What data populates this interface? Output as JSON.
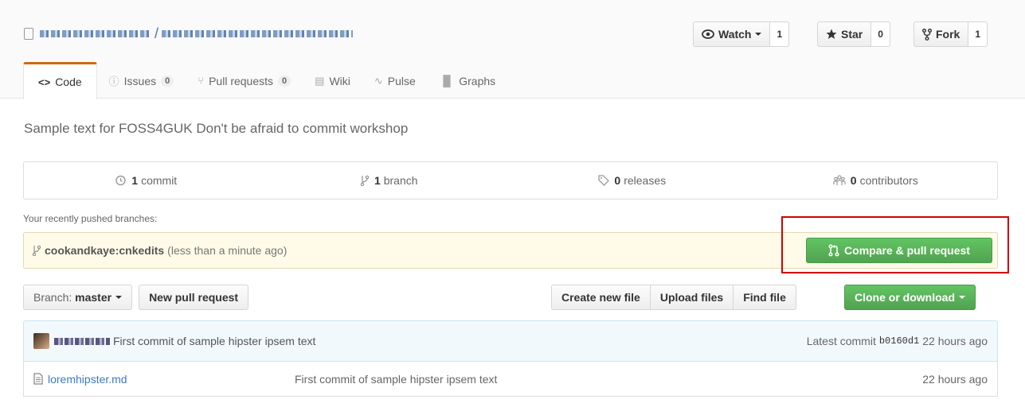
{
  "repo": {
    "owner_blurred": "",
    "name_blurred": "",
    "separator": "/"
  },
  "social": {
    "watch_label": "Watch",
    "watch_count": "1",
    "star_label": "Star",
    "star_count": "0",
    "fork_label": "Fork",
    "fork_count": "1"
  },
  "tabs": [
    {
      "label": "Code",
      "icon": "code-icon"
    },
    {
      "label": "Issues",
      "counter": "0",
      "icon": "issue-icon"
    },
    {
      "label": "Pull requests",
      "counter": "0",
      "icon": "pull-request-icon"
    },
    {
      "label": "Wiki",
      "icon": "book-icon"
    },
    {
      "label": "Pulse",
      "icon": "pulse-icon"
    },
    {
      "label": "Graphs",
      "icon": "graph-icon"
    }
  ],
  "description": "Sample text for FOSS4GUK Don't be afraid to commit workshop",
  "summary": {
    "commits_count": "1",
    "commits_label": "commit",
    "branches_count": "1",
    "branches_label": "branch",
    "releases_count": "0",
    "releases_label": "releases",
    "contributors_count": "0",
    "contributors_label": "contributors"
  },
  "recent": {
    "label": "Your recently pushed branches:",
    "branch": "cookandkaye:cnkedits",
    "ago": "(less than a minute ago)",
    "compare_button": "Compare & pull request"
  },
  "filebar": {
    "branch_prefix": "Branch:",
    "branch_name": "master",
    "new_pr": "New pull request",
    "create_file": "Create new file",
    "upload_files": "Upload files",
    "find_file": "Find file",
    "clone": "Clone or download"
  },
  "latest_commit": {
    "message": "First commit of sample hipster ipsem text",
    "prefix": "Latest commit",
    "sha": "b0160d1",
    "age": "22 hours ago"
  },
  "files": [
    {
      "name": "loremhipster.md",
      "message": "First commit of sample hipster ipsem text",
      "age": "22 hours ago"
    }
  ],
  "colors": {
    "accent_tab": "#d26911",
    "green_button": "#55a555",
    "highlight_box": "#d40000",
    "link": "#4078c0"
  }
}
